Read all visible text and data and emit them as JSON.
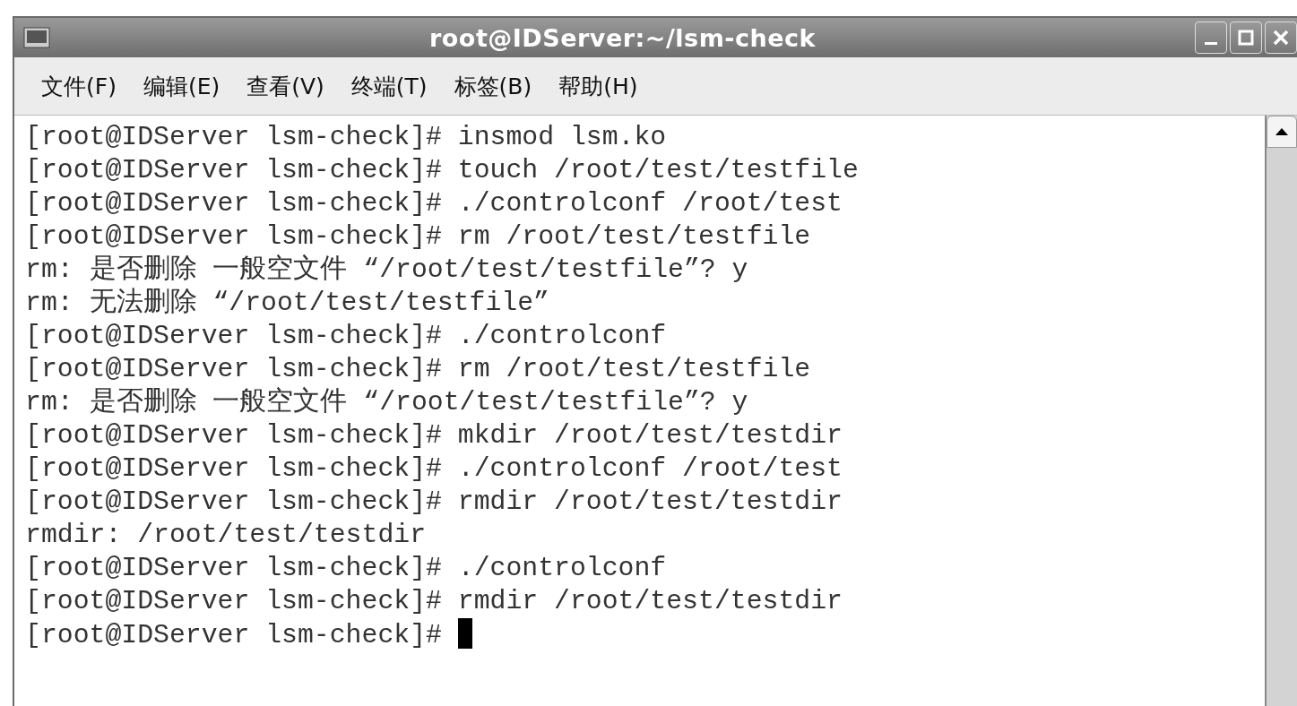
{
  "window": {
    "title": "root@IDServer:~/lsm-check"
  },
  "menu": [
    {
      "label": "文件(F)"
    },
    {
      "label": "编辑(E)"
    },
    {
      "label": "查看(V)"
    },
    {
      "label": "终端(T)"
    },
    {
      "label": "标签(B)"
    },
    {
      "label": "帮助(H)"
    }
  ],
  "terminal": {
    "cursor": true,
    "lines": [
      "[root@IDServer lsm-check]# insmod lsm.ko",
      "[root@IDServer lsm-check]# touch /root/test/testfile",
      "[root@IDServer lsm-check]# ./controlconf /root/test",
      "[root@IDServer lsm-check]# rm /root/test/testfile",
      "rm: 是否删除 一般空文件 “/root/test/testfile”? y",
      "rm: 无法删除 “/root/test/testfile”",
      "[root@IDServer lsm-check]# ./controlconf",
      "[root@IDServer lsm-check]# rm /root/test/testfile",
      "rm: 是否删除 一般空文件 “/root/test/testfile”? y",
      "[root@IDServer lsm-check]# mkdir /root/test/testdir",
      "[root@IDServer lsm-check]# ./controlconf /root/test",
      "[root@IDServer lsm-check]# rmdir /root/test/testdir",
      "rmdir: /root/test/testdir",
      "[root@IDServer lsm-check]# ./controlconf",
      "[root@IDServer lsm-check]# rmdir /root/test/testdir",
      "[root@IDServer lsm-check]# "
    ]
  }
}
